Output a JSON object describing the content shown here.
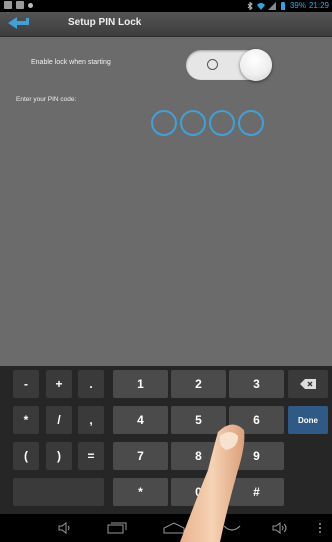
{
  "status_bar": {
    "battery_text": "39%",
    "time": "21:29",
    "icons": [
      "image-icon",
      "message-icon",
      "notification-icon",
      "bluetooth-icon",
      "wifi-icon",
      "signal-icon",
      "battery-icon"
    ]
  },
  "action_bar": {
    "title": "Setup PIN Lock",
    "back_icon": "back-arrow-icon"
  },
  "settings": {
    "enable_lock_label": "Enable lock when starting",
    "enable_lock_toggle_mark": "O",
    "pin_label": "Enter your PIN code:",
    "pin_length": 4,
    "pin_entered": 0
  },
  "keyboard": {
    "keys": [
      {
        "label": "-",
        "kind": "sym"
      },
      {
        "label": "+",
        "kind": "sym"
      },
      {
        "label": ".",
        "kind": "sym"
      },
      {
        "label": "1",
        "kind": "num"
      },
      {
        "label": "2",
        "kind": "num"
      },
      {
        "label": "3",
        "kind": "num"
      },
      {
        "label": "delete-icon",
        "kind": "del"
      },
      {
        "label": "*",
        "kind": "sym"
      },
      {
        "label": "/",
        "kind": "sym"
      },
      {
        "label": ",",
        "kind": "sym"
      },
      {
        "label": "4",
        "kind": "num"
      },
      {
        "label": "5",
        "kind": "num"
      },
      {
        "label": "6",
        "kind": "num"
      },
      {
        "label": "Done",
        "kind": "done"
      },
      {
        "label": "(",
        "kind": "sym"
      },
      {
        "label": ")",
        "kind": "sym"
      },
      {
        "label": "=",
        "kind": "sym"
      },
      {
        "label": "7",
        "kind": "num"
      },
      {
        "label": "8",
        "kind": "num"
      },
      {
        "label": "9",
        "kind": "num"
      },
      {
        "label": "*",
        "kind": "num"
      },
      {
        "label": "0",
        "kind": "num"
      },
      {
        "label": "#",
        "kind": "num"
      }
    ]
  },
  "nav_bar": {
    "icons": [
      "volume-down-icon",
      "recent-apps-icon",
      "home-icon",
      "back-icon",
      "volume-up-icon",
      "menu-icon"
    ]
  },
  "colors": {
    "background": "#6b6b6b",
    "accent": "#3fa1d8",
    "done_key": "#2f5a86"
  }
}
